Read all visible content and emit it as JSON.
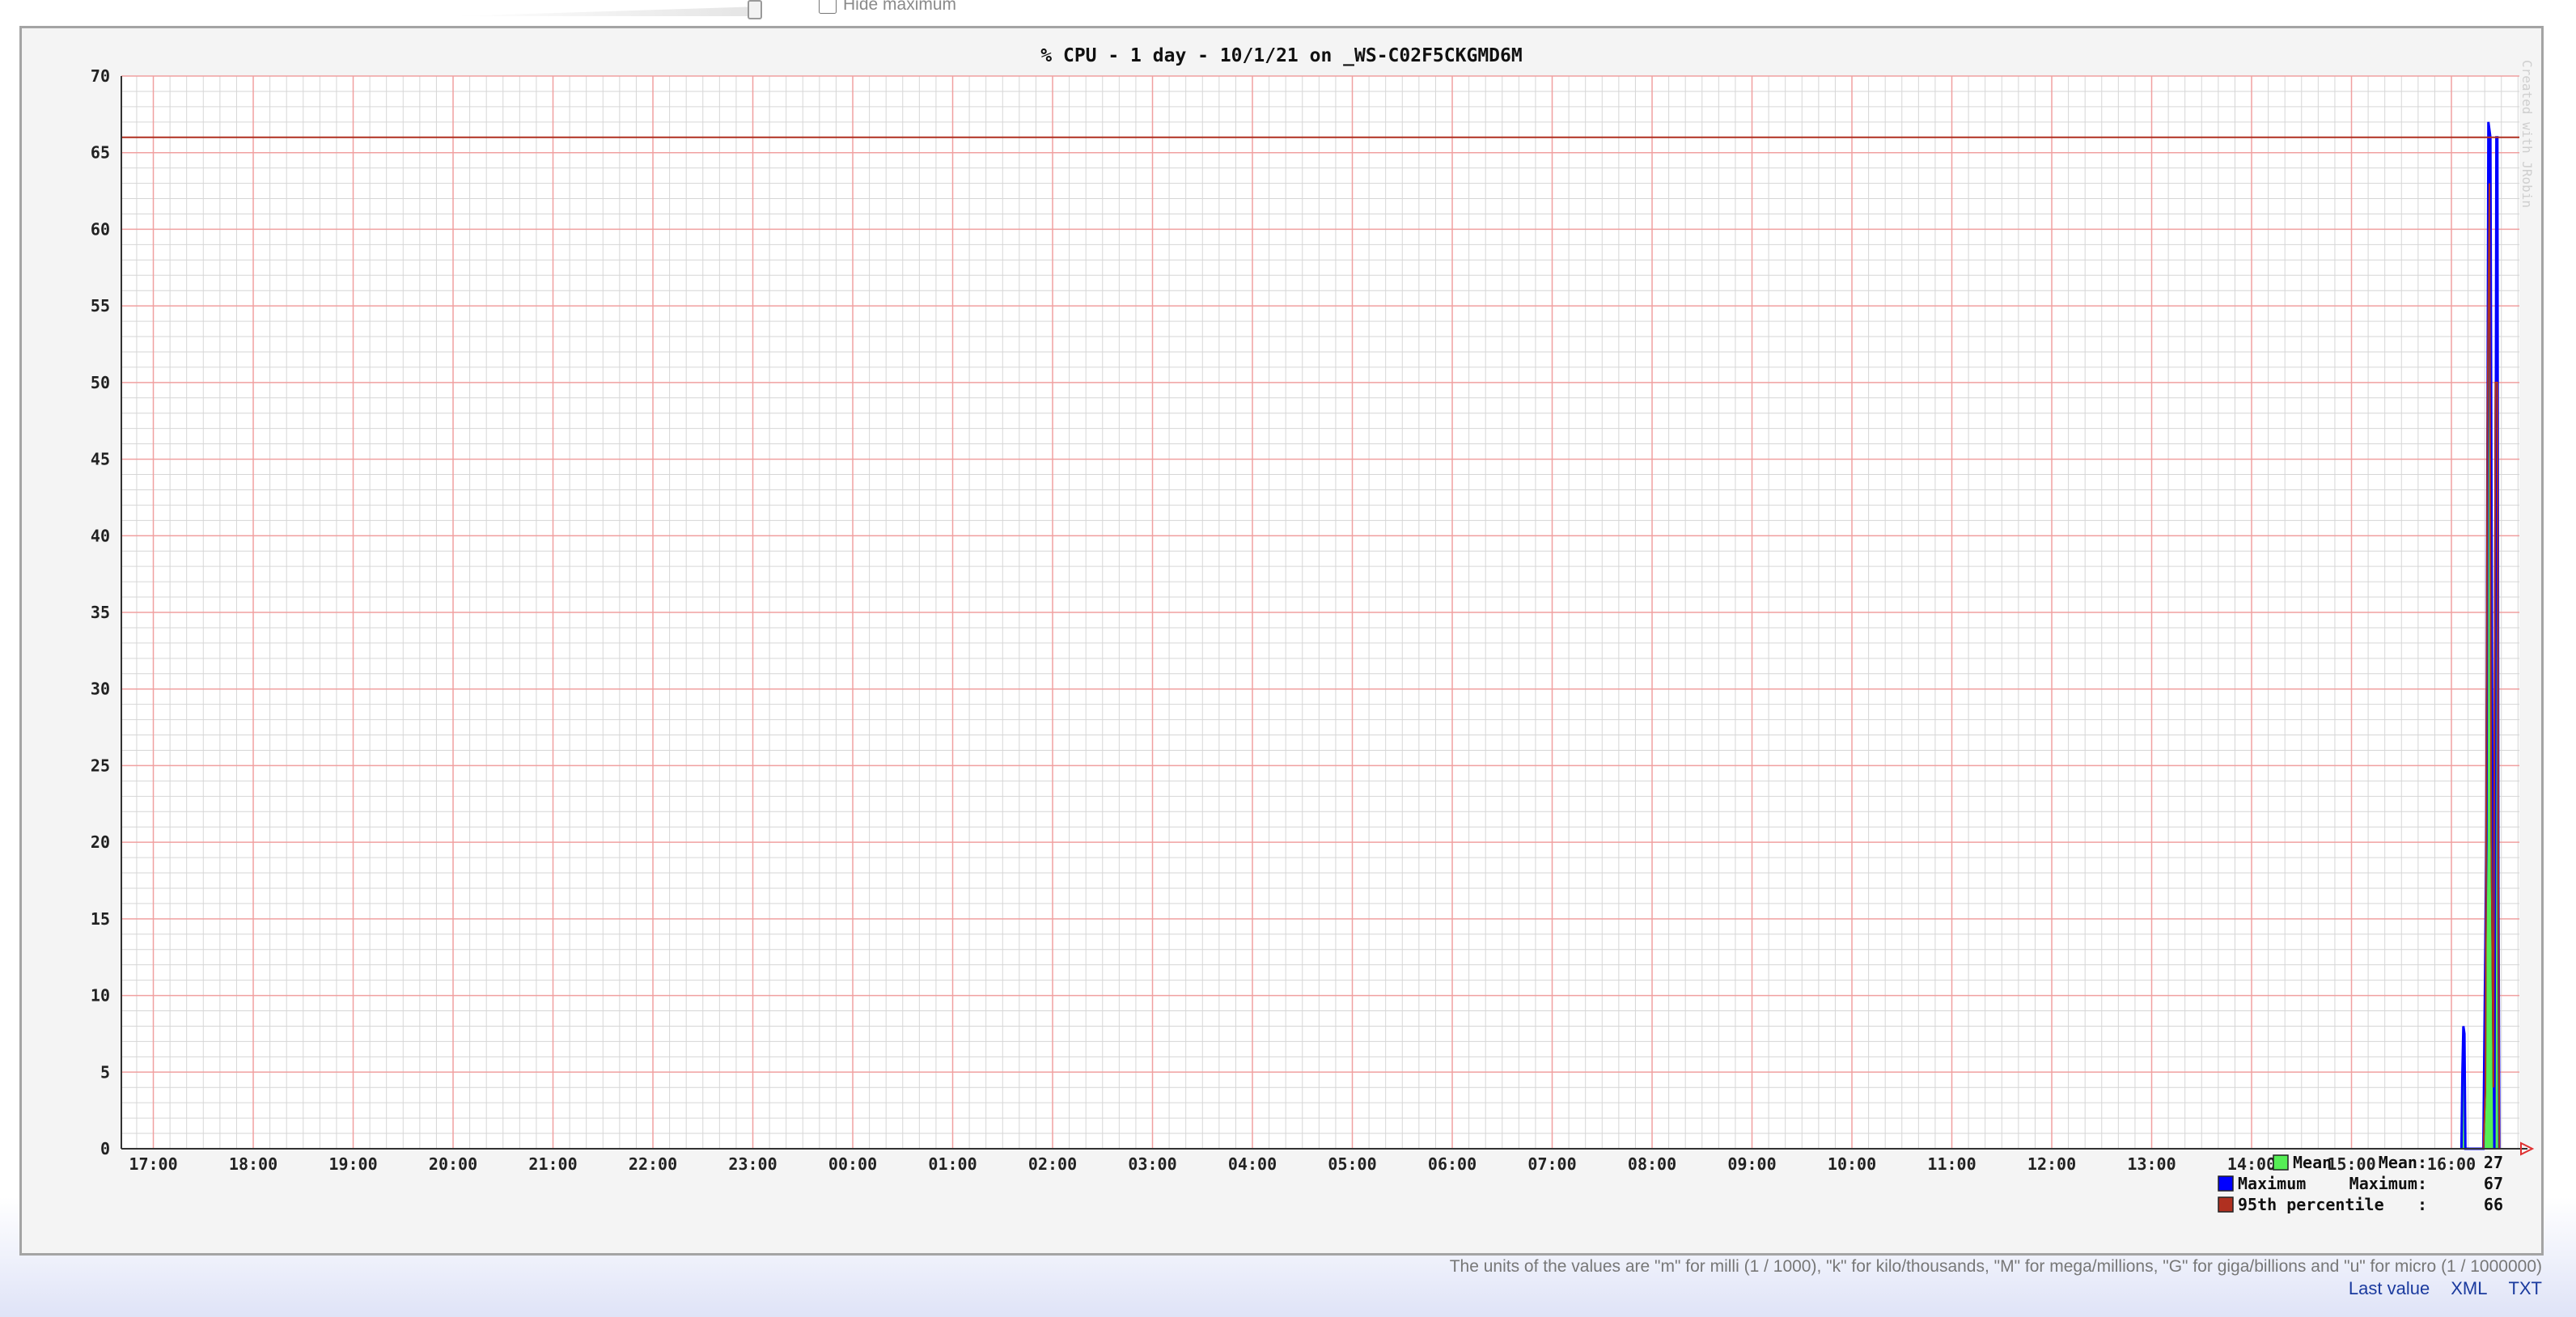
{
  "controls": {
    "hide_maximum_label": "Hide maximum",
    "hide_maximum_checked": false
  },
  "footer": {
    "units_note": "The units of the values are \"m\" for milli (1 / 1000), \"k\" for kilo/thousands, \"M\" for mega/millions, \"G\" for giga/billions and \"u\" for micro (1 / 1000000)",
    "links": [
      "Last value",
      "XML",
      "TXT"
    ]
  },
  "colors": {
    "mean": "#55ee55",
    "maximum": "#0000ff",
    "percentile": "#b03020",
    "major_grid": "#f0a0a0",
    "minor_grid": "#d6d6d6"
  },
  "chart_data": {
    "type": "area",
    "title": "% CPU - 1 day - 10/1/21 on _WS-C02F5CKGMD6M",
    "watermark": "Created with JRobin",
    "xlabel": "",
    "ylabel": "",
    "ylim": [
      0,
      70
    ],
    "yticks": [
      0,
      5,
      10,
      15,
      20,
      25,
      30,
      35,
      40,
      45,
      50,
      55,
      60,
      65,
      70
    ],
    "x_time_range_hours": [
      16.68,
      40.68
    ],
    "xticks": [
      "17:00",
      "18:00",
      "19:00",
      "20:00",
      "21:00",
      "22:00",
      "23:00",
      "00:00",
      "01:00",
      "02:00",
      "03:00",
      "04:00",
      "05:00",
      "06:00",
      "07:00",
      "08:00",
      "09:00",
      "10:00",
      "11:00",
      "12:00",
      "13:00",
      "14:00",
      "15:00",
      "16:00"
    ],
    "xtick_hours": [
      17,
      18,
      19,
      20,
      21,
      22,
      23,
      24,
      25,
      26,
      27,
      28,
      29,
      30,
      31,
      32,
      33,
      34,
      35,
      36,
      37,
      38,
      39,
      40
    ],
    "series": [
      {
        "name": "Mean",
        "points": [
          [
            40.1,
            0
          ],
          [
            40.11,
            4.5
          ],
          [
            40.12,
            6.5
          ],
          [
            40.13,
            6.5
          ],
          [
            40.14,
            0
          ],
          [
            40.32,
            0
          ],
          [
            40.34,
            4
          ],
          [
            40.36,
            48
          ],
          [
            40.38,
            63
          ],
          [
            40.4,
            20
          ],
          [
            40.42,
            4
          ],
          [
            40.44,
            50
          ],
          [
            40.46,
            50
          ],
          [
            40.47,
            16
          ],
          [
            40.48,
            0
          ]
        ]
      },
      {
        "name": "Maximum",
        "points": [
          [
            40.1,
            0
          ],
          [
            40.11,
            5
          ],
          [
            40.12,
            8
          ],
          [
            40.13,
            7.5
          ],
          [
            40.14,
            0
          ],
          [
            40.32,
            0
          ],
          [
            40.35,
            20
          ],
          [
            40.37,
            67
          ],
          [
            40.39,
            66
          ],
          [
            40.41,
            21
          ],
          [
            40.43,
            0
          ],
          [
            40.45,
            66
          ],
          [
            40.46,
            66
          ],
          [
            40.47,
            17
          ],
          [
            40.48,
            0
          ]
        ]
      }
    ],
    "percentile_line": {
      "name": "95th percentile",
      "value": 66
    },
    "legend": {
      "placement": "bottom-right",
      "entries": [
        {
          "label": "Mean",
          "stat": "Mean:",
          "value": "27"
        },
        {
          "label": "Maximum",
          "stat": "Maximum:",
          "value": "67"
        },
        {
          "label": "95th percentile",
          "stat": ":",
          "value": "66"
        }
      ]
    },
    "grid": true
  }
}
